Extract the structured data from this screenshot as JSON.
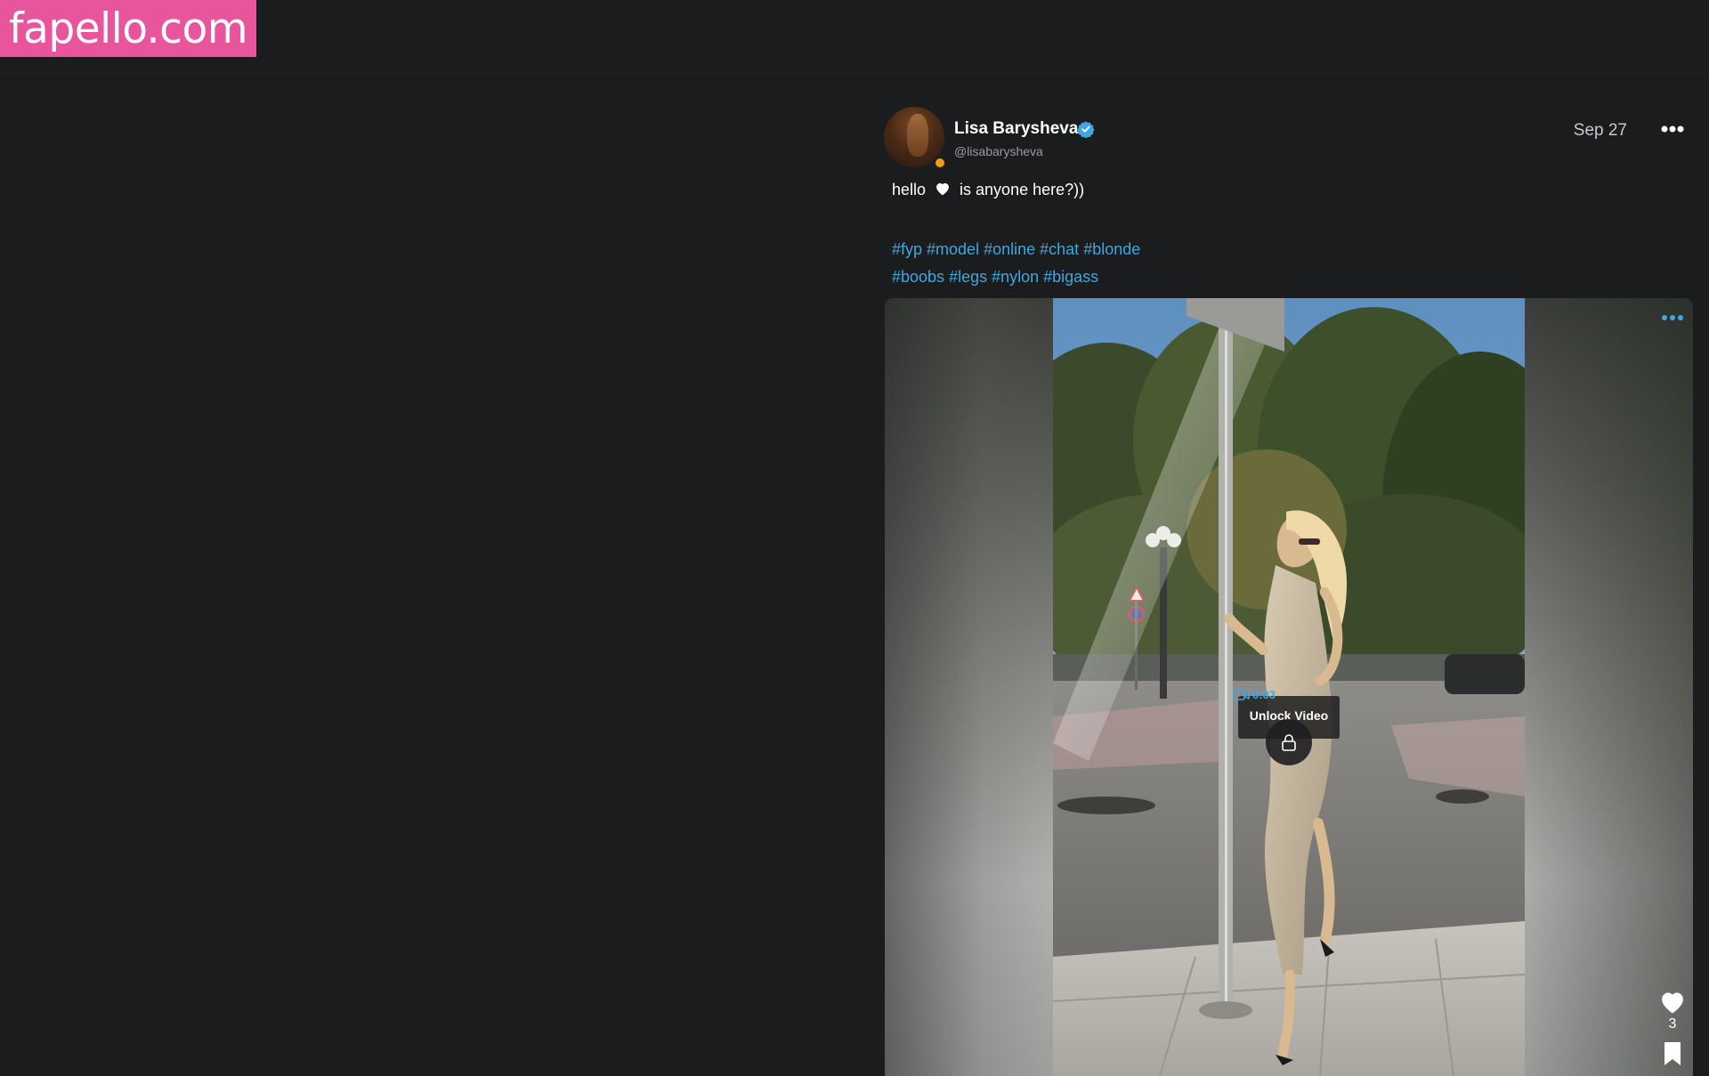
{
  "site": {
    "logo_text": "fapello.com",
    "brand_color": "#e8559d"
  },
  "post": {
    "author": {
      "name": "Lisa Barysheva",
      "handle": "@lisabarysheva",
      "verified": true,
      "online_status_color": "#f39c12"
    },
    "date": "Sep 27",
    "text_before_icon": "hello",
    "text_icon": "heart-icon",
    "text_after_icon": "is anyone here?))",
    "tags": [
      "#fyp",
      "#model",
      "#online",
      "#chat",
      "#blonde",
      "#boobs",
      "#legs",
      "#nylon",
      "#bigass"
    ],
    "tag_color": "#3fa7e0",
    "media": {
      "type": "video",
      "duration": "0:03",
      "locked": true,
      "unlock_label": "Unlock Video"
    },
    "likes": "3"
  },
  "icons": {
    "more_top": "more-horizontal-icon",
    "more_media": "more-horizontal-icon",
    "verified": "verified-badge-icon",
    "lock": "lock-icon",
    "like": "heart-icon",
    "bookmark": "bookmark-icon",
    "video": "video-camera-icon"
  }
}
